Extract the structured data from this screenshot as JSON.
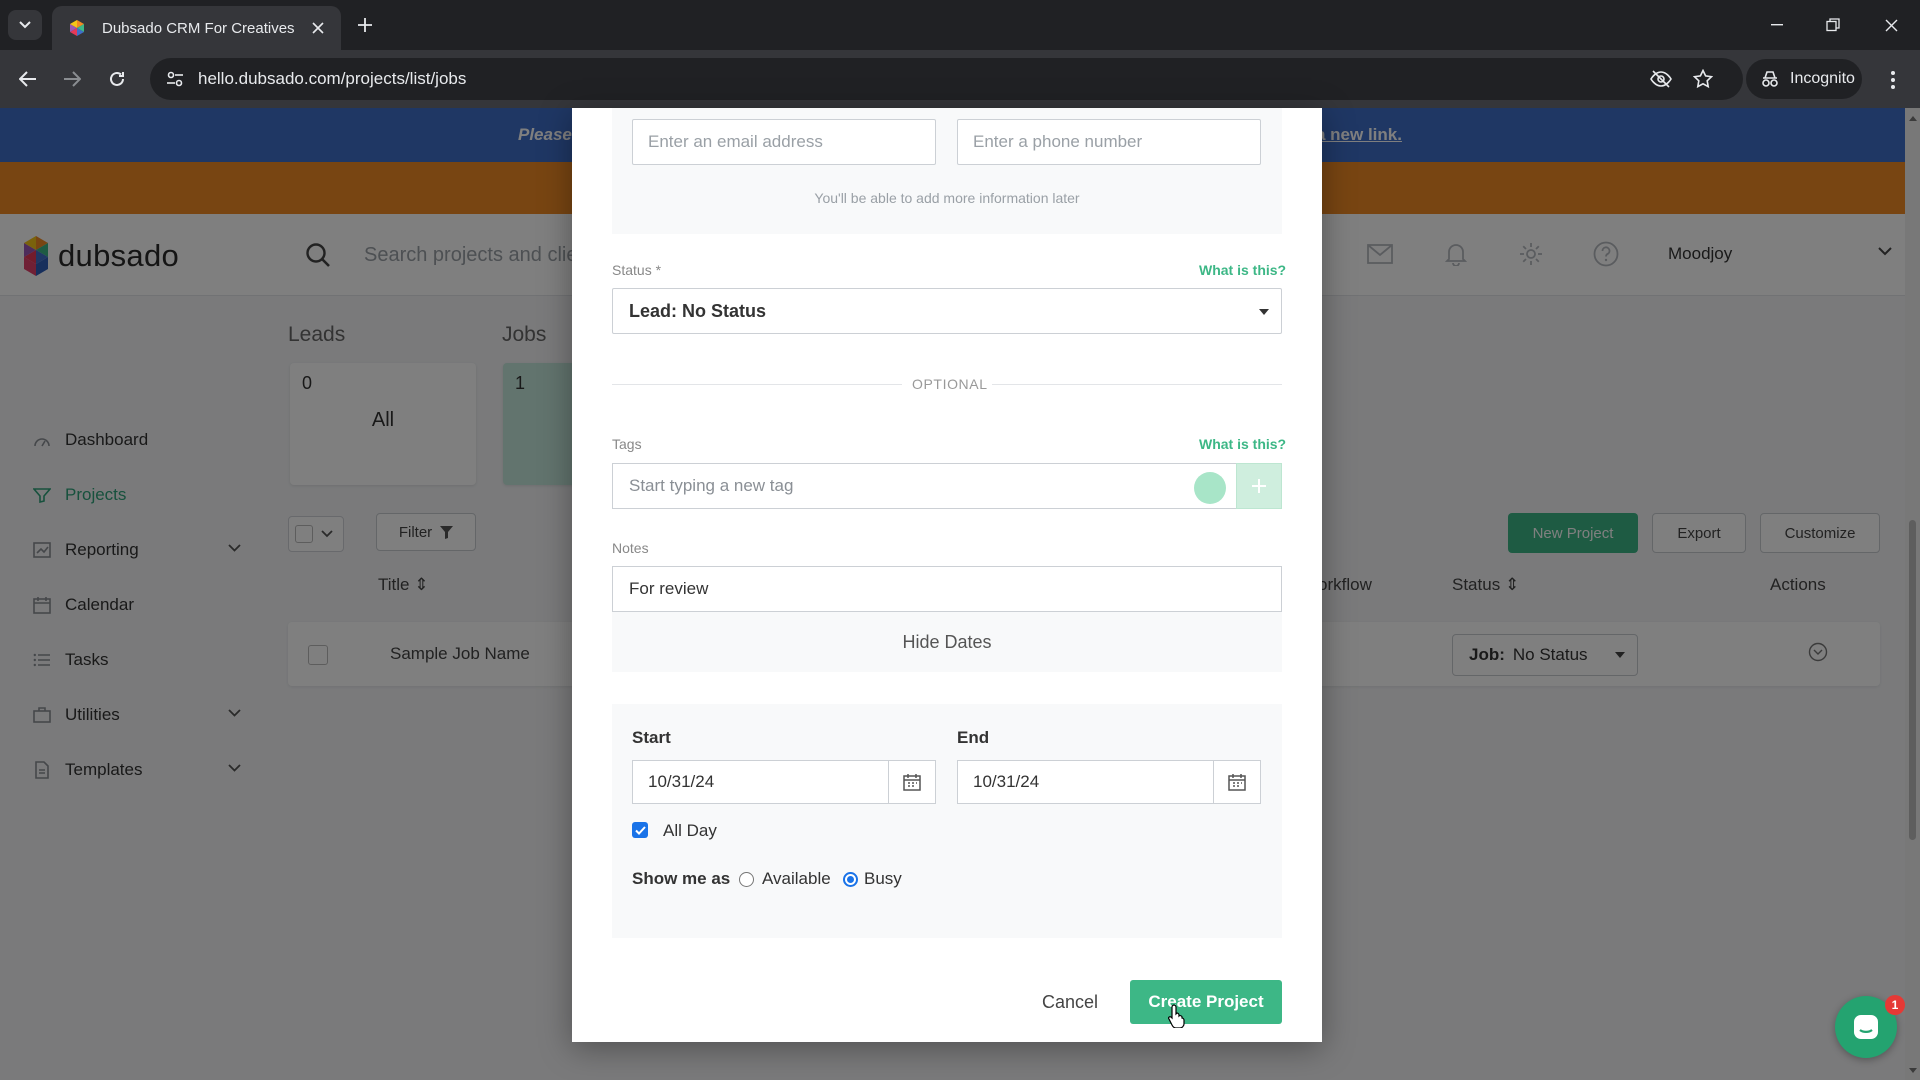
{
  "browser": {
    "tab_title": "Dubsado CRM For Creatives",
    "url": "hello.dubsado.com/projects/list/jobs",
    "profile": "Incognito"
  },
  "banner": {
    "left_text": "Please",
    "link_text": "a new link."
  },
  "header": {
    "logo": "dubsado",
    "search_placeholder": "Search projects and clie",
    "user_name": "Moodjoy"
  },
  "sidebar": {
    "items": [
      {
        "label": "Dashboard"
      },
      {
        "label": "Projects"
      },
      {
        "label": "Reporting"
      },
      {
        "label": "Calendar"
      },
      {
        "label": "Tasks"
      },
      {
        "label": "Utilities"
      },
      {
        "label": "Templates"
      }
    ]
  },
  "content": {
    "leads_title": "Leads",
    "jobs_title": "Jobs",
    "leads_card": {
      "count": "0",
      "label": "All"
    },
    "jobs_card": {
      "count": "1"
    },
    "filter_label": "Filter",
    "new_project_label": "New Project",
    "export_label": "Export",
    "customize_label": "Customize",
    "columns": {
      "title": "Title",
      "workflow": "orkflow",
      "status": "Status",
      "actions": "Actions"
    },
    "row": {
      "name": "Sample Job Name",
      "status_prefix": "Job:",
      "status_value": "No Status"
    }
  },
  "modal": {
    "email_placeholder": "Enter an email address",
    "phone_placeholder": "Enter a phone number",
    "helper_text": "You'll be able to add more information later",
    "status_label": "Status *",
    "what_is_this": "What is this?",
    "status_value": "Lead: No Status",
    "optional_label": "OPTIONAL",
    "tags_label": "Tags",
    "tags_placeholder": "Start typing a new tag",
    "notes_label": "Notes",
    "notes_value": "For review",
    "hide_dates_label": "Hide Dates",
    "start_label": "Start",
    "start_value": "10/31/24",
    "end_label": "End",
    "end_value": "10/31/24",
    "all_day_label": "All Day",
    "all_day_checked": true,
    "show_me_as_label": "Show me as",
    "available_label": "Available",
    "busy_label": "Busy",
    "selected_availability": "Busy",
    "cancel_label": "Cancel",
    "create_label": "Create Project"
  },
  "chat": {
    "badge": "1"
  },
  "colors": {
    "accent_green": "#3db786",
    "banner_blue": "#3f6fc9",
    "banner_orange": "#f08a24"
  }
}
